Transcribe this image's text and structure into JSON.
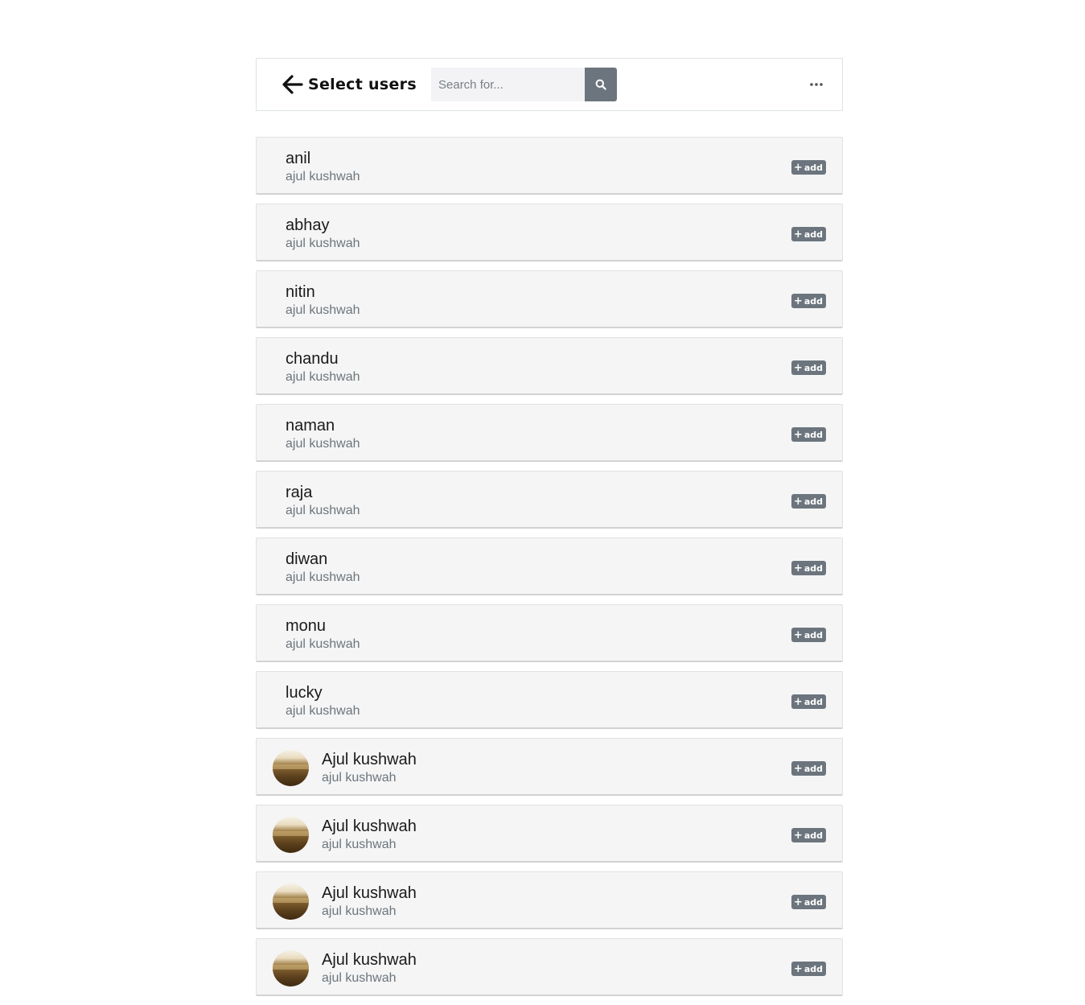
{
  "header": {
    "title": "Select users",
    "search_placeholder": "Search for...",
    "back_icon": "arrow-left-icon",
    "search_icon": "search-icon",
    "more_icon": "ellipsis-icon"
  },
  "colors": {
    "badge": "#6c757d",
    "card_bg": "#f5f5f5",
    "search_bg": "#f3f3f5"
  },
  "users": [
    {
      "name": "anil",
      "subtitle": "ajul kushwah",
      "action": "add",
      "avatar": false
    },
    {
      "name": "abhay",
      "subtitle": "ajul kushwah",
      "action": "add",
      "avatar": false
    },
    {
      "name": "nitin",
      "subtitle": "ajul kushwah",
      "action": "add",
      "avatar": false
    },
    {
      "name": "chandu",
      "subtitle": "ajul kushwah",
      "action": "add",
      "avatar": false
    },
    {
      "name": "naman",
      "subtitle": "ajul kushwah",
      "action": "add",
      "avatar": false
    },
    {
      "name": "raja",
      "subtitle": "ajul kushwah",
      "action": "add",
      "avatar": false
    },
    {
      "name": "diwan",
      "subtitle": "ajul kushwah",
      "action": "add",
      "avatar": false
    },
    {
      "name": "monu",
      "subtitle": "ajul kushwah",
      "action": "add",
      "avatar": false
    },
    {
      "name": "lucky",
      "subtitle": "ajul kushwah",
      "action": "add",
      "avatar": false
    },
    {
      "name": "Ajul kushwah",
      "subtitle": "ajul kushwah",
      "action": "add",
      "avatar": true
    },
    {
      "name": "Ajul kushwah",
      "subtitle": "ajul kushwah",
      "action": "add",
      "avatar": true
    },
    {
      "name": "Ajul kushwah",
      "subtitle": "ajul kushwah",
      "action": "add",
      "avatar": true
    },
    {
      "name": "Ajul kushwah",
      "subtitle": "ajul kushwah",
      "action": "add",
      "avatar": true
    }
  ]
}
